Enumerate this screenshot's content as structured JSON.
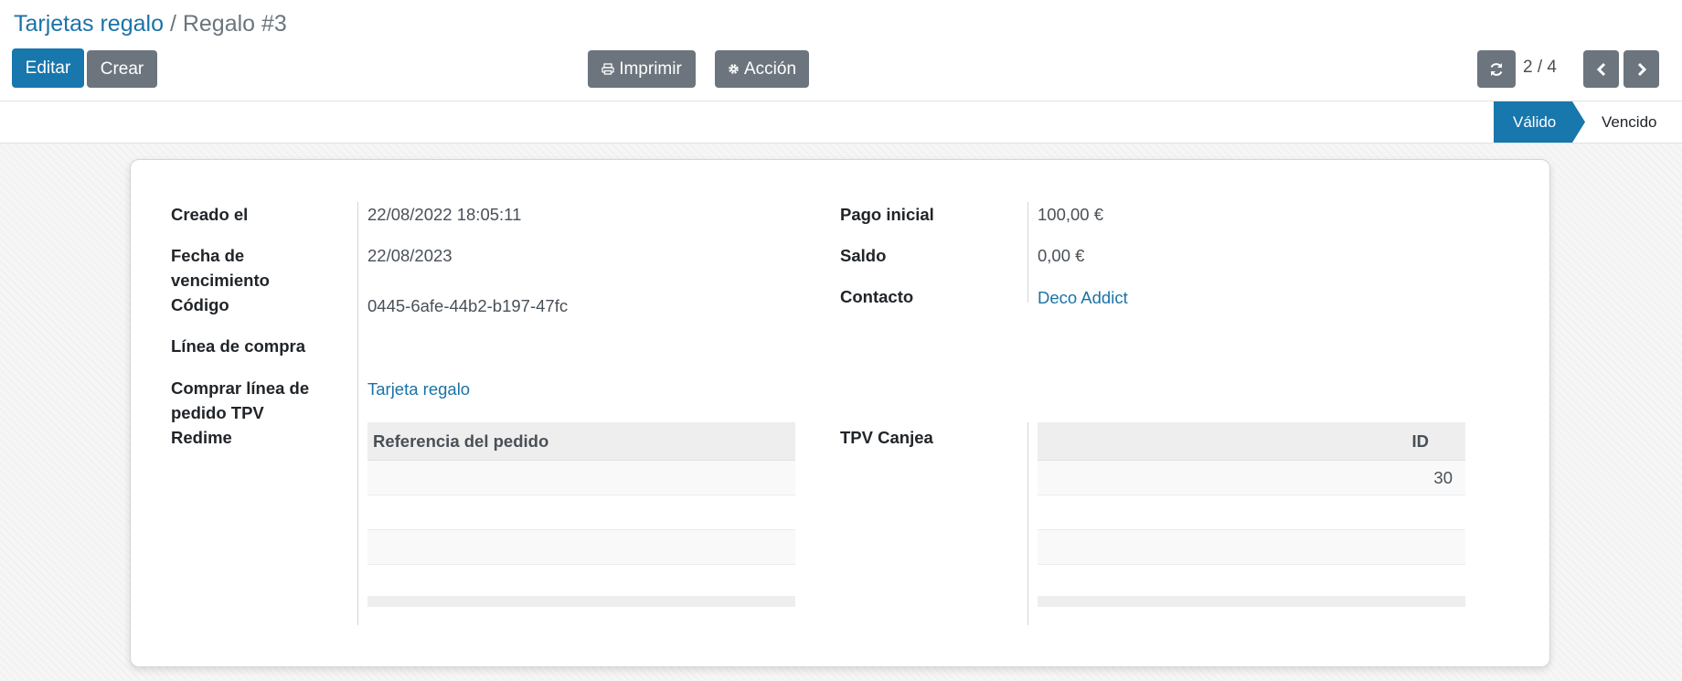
{
  "breadcrumb": {
    "parent": "Tarjetas regalo",
    "separator": "/",
    "current": "Regalo #3"
  },
  "toolbar": {
    "edit_label": "Editar",
    "create_label": "Crear",
    "print_label": "Imprimir",
    "print_icon": "printer-icon",
    "action_label": "Acción",
    "action_icon": "gear-icon"
  },
  "pager": {
    "value": "2 / 4",
    "refresh_icon": "refresh-icon",
    "prev_icon": "chevron-left-icon",
    "next_icon": "chevron-right-icon"
  },
  "statusbar": {
    "stages": [
      "Válido",
      "Vencido"
    ],
    "active": "Válido"
  },
  "form": {
    "left": {
      "created_on_label": "Creado el",
      "created_on_value": "22/08/2022 18:05:11",
      "expiry_label_1": "Fecha de",
      "expiry_label_2": "vencimiento",
      "expiry_value": "22/08/2023",
      "code_label": "Código",
      "code_value": "0445-6afe-44b2-b197-47fc",
      "purchase_line_label": "Línea de compra",
      "pos_line_label_1": "Comprar línea de",
      "pos_line_label_2": "pedido TPV",
      "pos_line_value": "Tarjeta regalo",
      "redeem_label": "Redime",
      "redeem_table_header": "Referencia del pedido"
    },
    "right": {
      "initial_payment_label": "Pago inicial",
      "initial_payment_value": "100,00 €",
      "balance_label": "Saldo",
      "balance_value": "0,00 €",
      "contact_label": "Contacto",
      "contact_value": "Deco Addict",
      "pos_redeem_label": "TPV Canjea",
      "pos_redeem_table_header": "ID",
      "pos_redeem_rows": [
        "30"
      ]
    }
  },
  "colors": {
    "primary": "#1877ac",
    "secondary": "#6c757d",
    "link": "#1a73a8"
  }
}
